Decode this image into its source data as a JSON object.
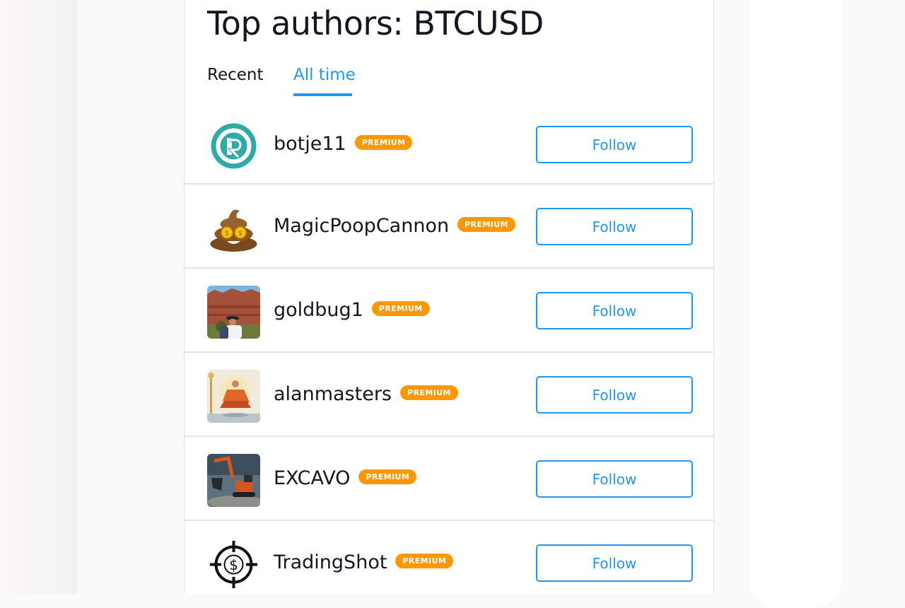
{
  "page": {
    "title": "Top authors: BTCUSD",
    "accent_color": "#2196f3",
    "badge_color": "#ff9800"
  },
  "tabs": [
    {
      "label": "Recent",
      "active": false
    },
    {
      "label": "All time",
      "active": true
    }
  ],
  "authors": [
    {
      "name": "botje11",
      "badge": "PREMIUM",
      "follow_label": "Follow",
      "avatar": "teal-circle-logo"
    },
    {
      "name": "MagicPoopCannon",
      "badge": "PREMIUM",
      "follow_label": "Follow",
      "avatar": "poop-emoji"
    },
    {
      "name": "goldbug1",
      "badge": "PREMIUM",
      "follow_label": "Follow",
      "avatar": "desert-photo"
    },
    {
      "name": "alanmasters",
      "badge": "PREMIUM",
      "follow_label": "Follow",
      "avatar": "monk-painting"
    },
    {
      "name": "EXCAVO",
      "badge": "PREMIUM",
      "follow_label": "Follow",
      "avatar": "excavator-photo"
    },
    {
      "name": "TradingShot",
      "badge": "PREMIUM",
      "follow_label": "Follow",
      "avatar": "crosshair-dollar-icon"
    }
  ]
}
